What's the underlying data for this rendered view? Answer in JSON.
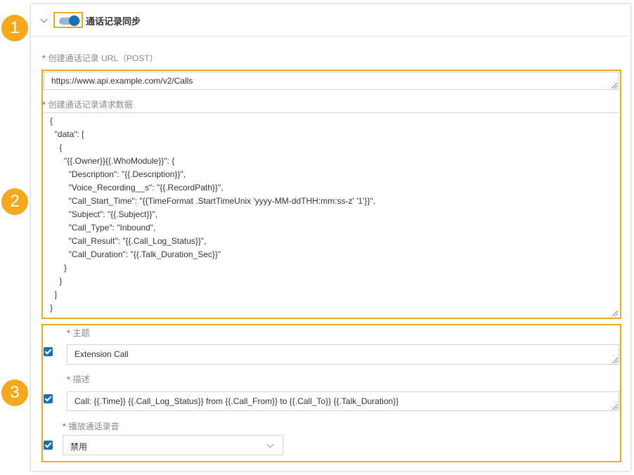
{
  "header": {
    "title": "通话记录同步",
    "sync_enabled": true
  },
  "badges": [
    "1",
    "2",
    "3"
  ],
  "url_section": {
    "required_mark": "*",
    "label": "创建通话记录 URL（POST）",
    "value": "https://www.api.example.com/v2/Calls"
  },
  "request_section": {
    "required_mark": "*",
    "label": "创建通话记录请求数据",
    "lines": [
      "{",
      "  \"data\": [",
      "    {",
      "      \"{{.Owner}}{{.WhoModule}}\": {",
      "        \"Description\": \"{{.Description}}\",",
      "        \"Voice_Recording__s\": \"{{.RecordPath}}\",",
      "        \"Call_Start_Time\": \"{{TimeFormat .StartTimeUnix 'yyyy-MM-ddTHH:mm:ss-z' '1'}}\",",
      "        \"Subject\": \"{{.Subject}}\",",
      "        \"Call_Type\": \"Inbound\",",
      "        \"Call_Result\": \"{{.Call_Log_Status}}\",",
      "        \"Call_Duration\": \"{{.Talk_Duration_Sec}}\"",
      "      }",
      "    }",
      "  ]",
      "}"
    ]
  },
  "fields": {
    "subject": {
      "required_mark": "*",
      "label": "主题",
      "checked": true,
      "value": "Extension Call"
    },
    "description": {
      "required_mark": "*",
      "label": "描述",
      "checked": true,
      "value": "Call: {{.Time}} {{.Call_Log_Status}} from {{.Call_From}} to {{.Call_To}} {{.Talk_Duration}}"
    },
    "play_recording": {
      "required_mark": "*",
      "label": "播放通话录音",
      "checked": true,
      "value": "禁用"
    }
  },
  "colors": {
    "highlight": "#f0a91c",
    "badge": "#f5a81c",
    "accent": "#1a6fb5",
    "required": "#e0301e"
  }
}
